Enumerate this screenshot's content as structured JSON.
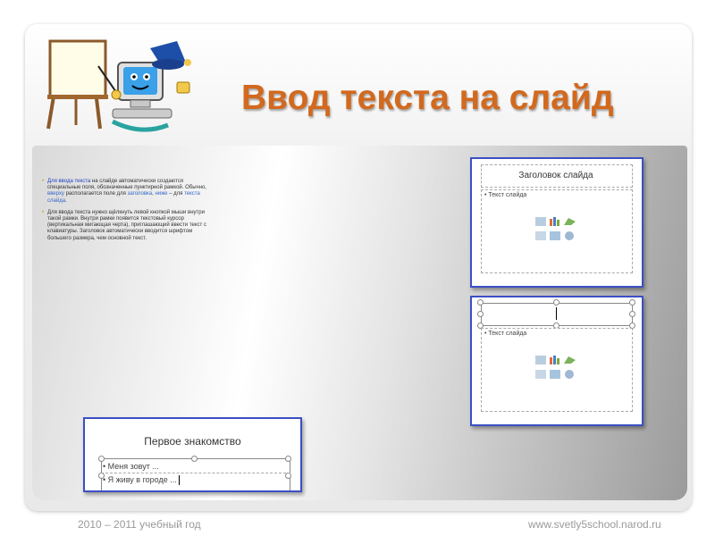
{
  "slide": {
    "title": "Ввод текста на слайд"
  },
  "body": {
    "p1": {
      "hl1": "Для ввода текста",
      "t1": " на слайде автоматически создаются специальные поля, обозначенные пунктирной рамкой.",
      "t2": " Обычно, ",
      "hl2": "вверху",
      "t3": " располагается поле для ",
      "hl3": "заголовка",
      "t4": ", ",
      "hl4": "ниже",
      "t5": " – для ",
      "hl5": "текста слайда",
      "t6": "."
    },
    "p2": "Для ввода текста нужно щёлкнуть левой кнопкой мыши внутри такой рамки. Внутри рамки появится текстовый курсор (вертикальная мигающая черта), приглашающий ввести текст с клавиатуры. Заголовок автоматически вводится шрифтом большего размера, чем основной текст."
  },
  "thumb1": {
    "title": "Заголовок слайда",
    "bullet": "• Текст слайда"
  },
  "thumb2": {
    "bullet": "• Текст слайда"
  },
  "thumb3": {
    "title": "Первое знакомство",
    "item1": "• Меня зовут ...",
    "item2": "• Я живу в городе ..."
  },
  "footer": {
    "year": "2010 – 2011 учебный год",
    "site": "www.svetly5school.narod.ru"
  },
  "colors": {
    "title": "#d2691e",
    "thumb_border": "#3b4fc4",
    "highlight": "#1f3fbf"
  }
}
